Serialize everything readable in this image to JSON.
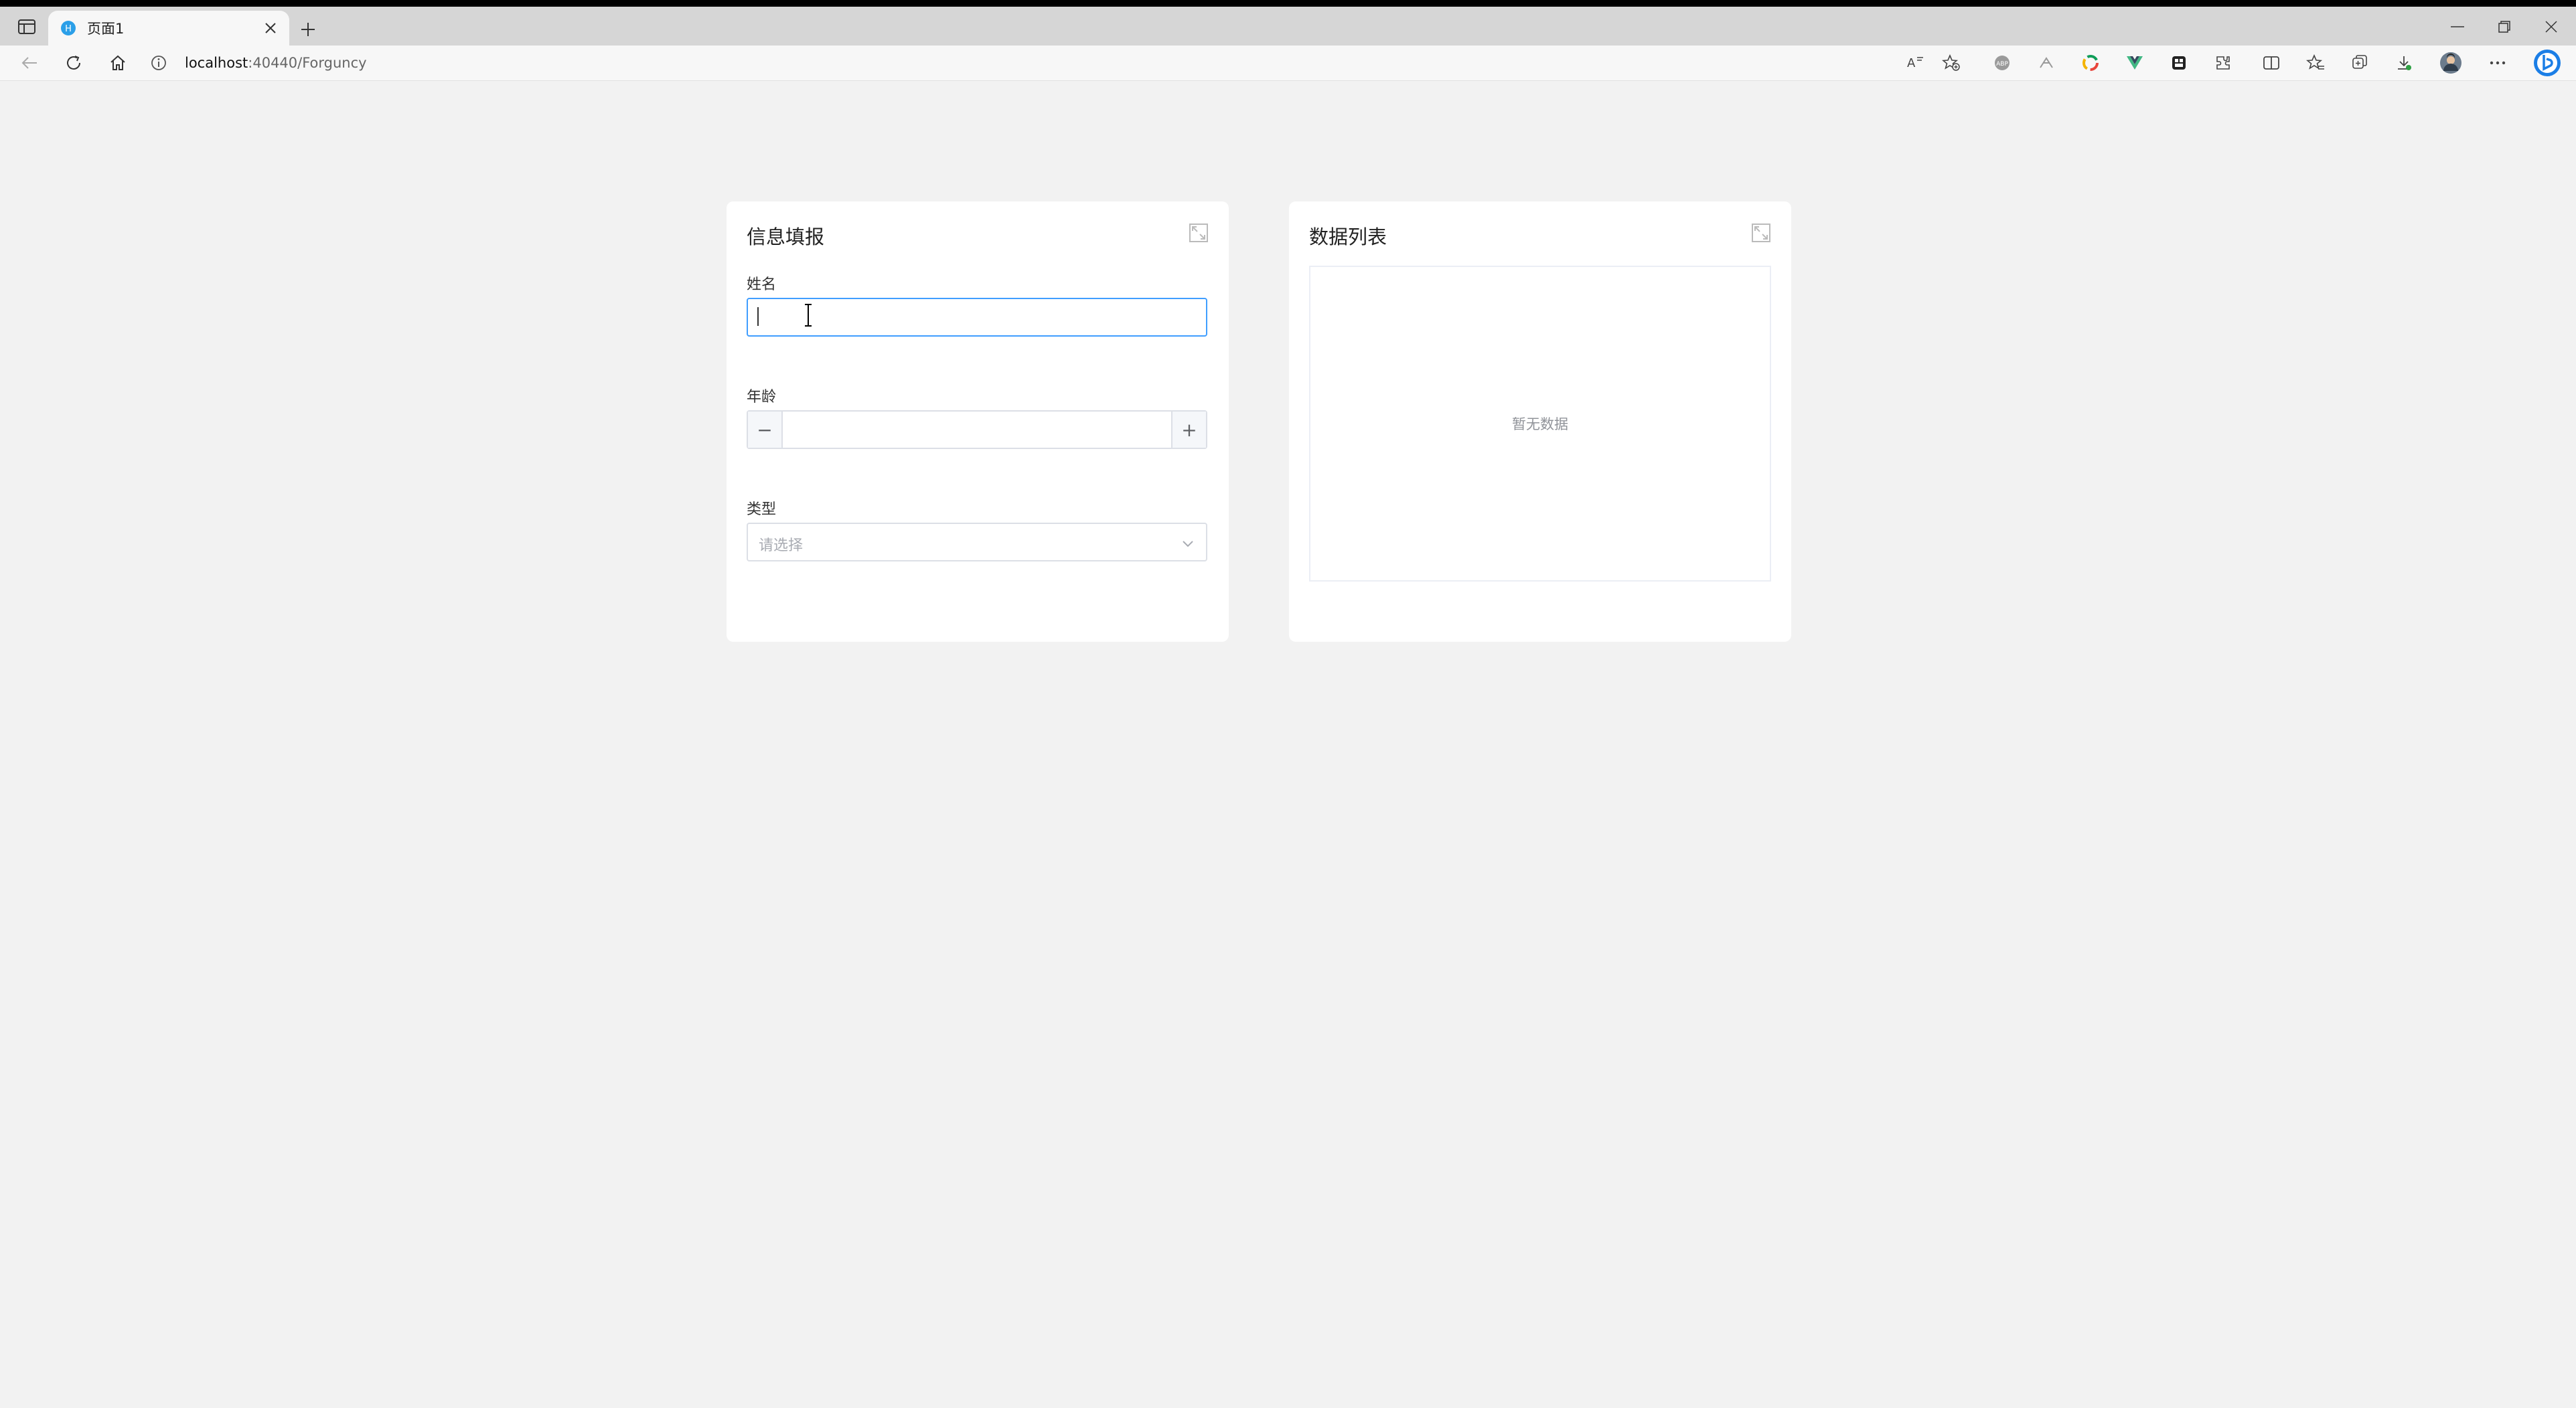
{
  "browser": {
    "tab_title": "页面1",
    "url_host": "localhost",
    "url_path": ":40440/Forguncy"
  },
  "form_card": {
    "title": "信息填报",
    "name_label": "姓名",
    "name_value": "",
    "age_label": "年龄",
    "age_value": "",
    "type_label": "类型",
    "type_placeholder": "请选择"
  },
  "list_card": {
    "title": "数据列表",
    "empty_text": "暂无数据"
  },
  "colors": {
    "accent": "#409eff",
    "page_bg": "#f2f2f2",
    "card_bg": "#ffffff"
  },
  "icons": [
    "window-menu-icon",
    "favicon-icon",
    "close-icon",
    "plus-icon",
    "minimize-icon",
    "restore-icon",
    "back-icon",
    "reload-icon",
    "home-icon",
    "info-icon",
    "read-aloud-icon",
    "favorite-add-icon",
    "extension-icon",
    "split-screen-icon",
    "favorites-icon",
    "collections-icon",
    "download-icon",
    "avatar",
    "more-icon",
    "bing-icon",
    "expand-icon",
    "chevron-down-icon"
  ]
}
